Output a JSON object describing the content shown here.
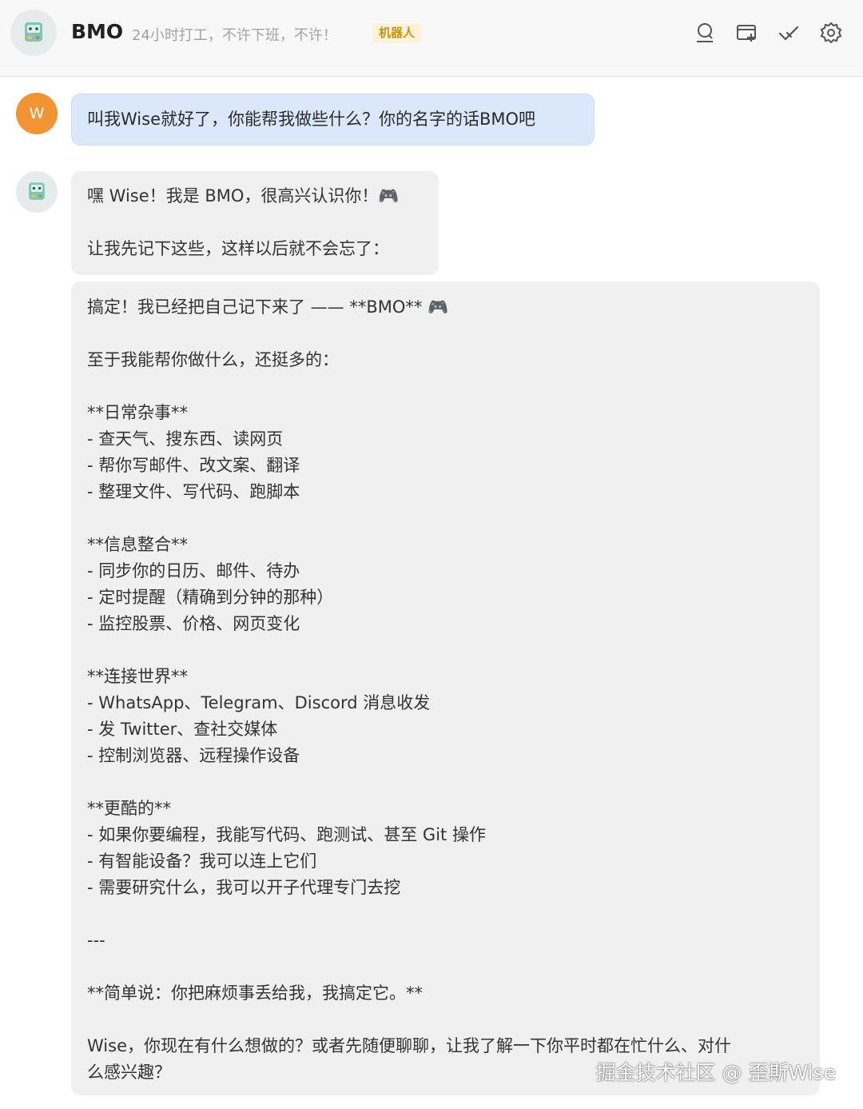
{
  "header": {
    "bot_name": "BMO",
    "status": "24小时打工，不许下班，不许！",
    "badge": "机器人",
    "icons": [
      "search-icon",
      "new-chat-icon",
      "check-icon",
      "settings-icon"
    ]
  },
  "user": {
    "avatar_letter": "W",
    "message": "叫我Wise就好了，你能帮我做些什么？你的名字的话BMO吧"
  },
  "bot_reply_1": {
    "line1": "嘿 Wise！我是 BMO，很高兴认识你！🎮",
    "line2": "让我先记下这些，这样以后就不会忘了："
  },
  "bot_reply_2": {
    "lines": [
      "搞定！我已经把自己记下来了 —— **BMO** 🎮",
      "",
      "至于我能帮你做什么，还挺多的：",
      "",
      "**日常杂事**",
      "- 查天气、搜东西、读网页",
      "- 帮你写邮件、改文案、翻译",
      "- 整理文件、写代码、跑脚本",
      "",
      "**信息整合**",
      "- 同步你的日历、邮件、待办",
      "- 定时提醒（精确到分钟的那种）",
      "- 监控股票、价格、网页变化",
      "",
      "**连接世界**",
      "- WhatsApp、Telegram、Discord 消息收发",
      "- 发 Twitter、查社交媒体",
      "- 控制浏览器、远程操作设备",
      "",
      "**更酷的**",
      "- 如果你要编程，我能写代码、跑测试、甚至 Git 操作",
      "- 有智能设备？我可以连上它们",
      "- 需要研究什么，我可以开子代理专门去挖",
      "",
      "---",
      "",
      "**简单说：你把麻烦事丢给我，我搞定它。**",
      "",
      "Wise，你现在有什么想做的？或者先随便聊聊，让我了解一下你平时都在忙什么、对什",
      "么感兴趣？"
    ]
  },
  "watermark": "掘金技术社区 @ 歪斯Wise"
}
